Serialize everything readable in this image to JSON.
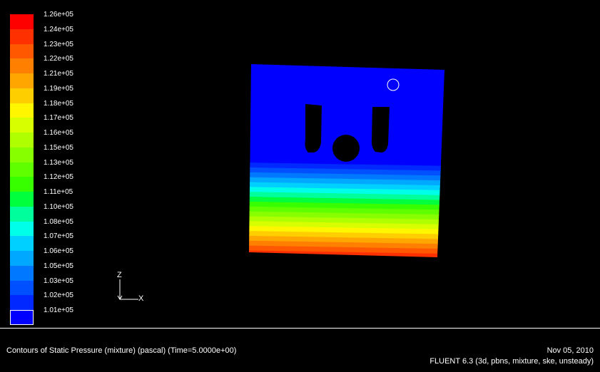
{
  "chart_data": {
    "type": "heatmap",
    "quantity": "Static Pressure (mixture)",
    "unit": "pascal",
    "legend_levels": [
      "1.26e+05",
      "1.24e+05",
      "1.23e+05",
      "1.22e+05",
      "1.21e+05",
      "1.19e+05",
      "1.18e+05",
      "1.17e+05",
      "1.16e+05",
      "1.15e+05",
      "1.13e+05",
      "1.12e+05",
      "1.11e+05",
      "1.10e+05",
      "1.08e+05",
      "1.07e+05",
      "1.06e+05",
      "1.05e+05",
      "1.03e+05",
      "1.02e+05",
      "1.01e+05"
    ],
    "legend_colors": [
      "#ff0000",
      "#ff3000",
      "#ff5800",
      "#ff7f00",
      "#ffa700",
      "#ffce00",
      "#fff600",
      "#d8ff00",
      "#b0ff00",
      "#88ff00",
      "#60ff00",
      "#38ff00",
      "#00ff3c",
      "#00ff9c",
      "#00ffe8",
      "#00d0ff",
      "#00a8ff",
      "#0078ff",
      "#0050ff",
      "#0028ff",
      "#0000ff"
    ],
    "pressure_gradient": {
      "top": "1.01e+05",
      "bottom": "1.26e+05"
    }
  },
  "axes": {
    "z_label": "Z",
    "x_label": "X"
  },
  "footer": {
    "caption": "Contours of Static Pressure (mixture)  (pascal)  (Time=5.0000e+00)",
    "date": "Nov 05, 2010",
    "solver": "FLUENT 6.3 (3d, pbns, mixture, ske, unsteady)"
  }
}
